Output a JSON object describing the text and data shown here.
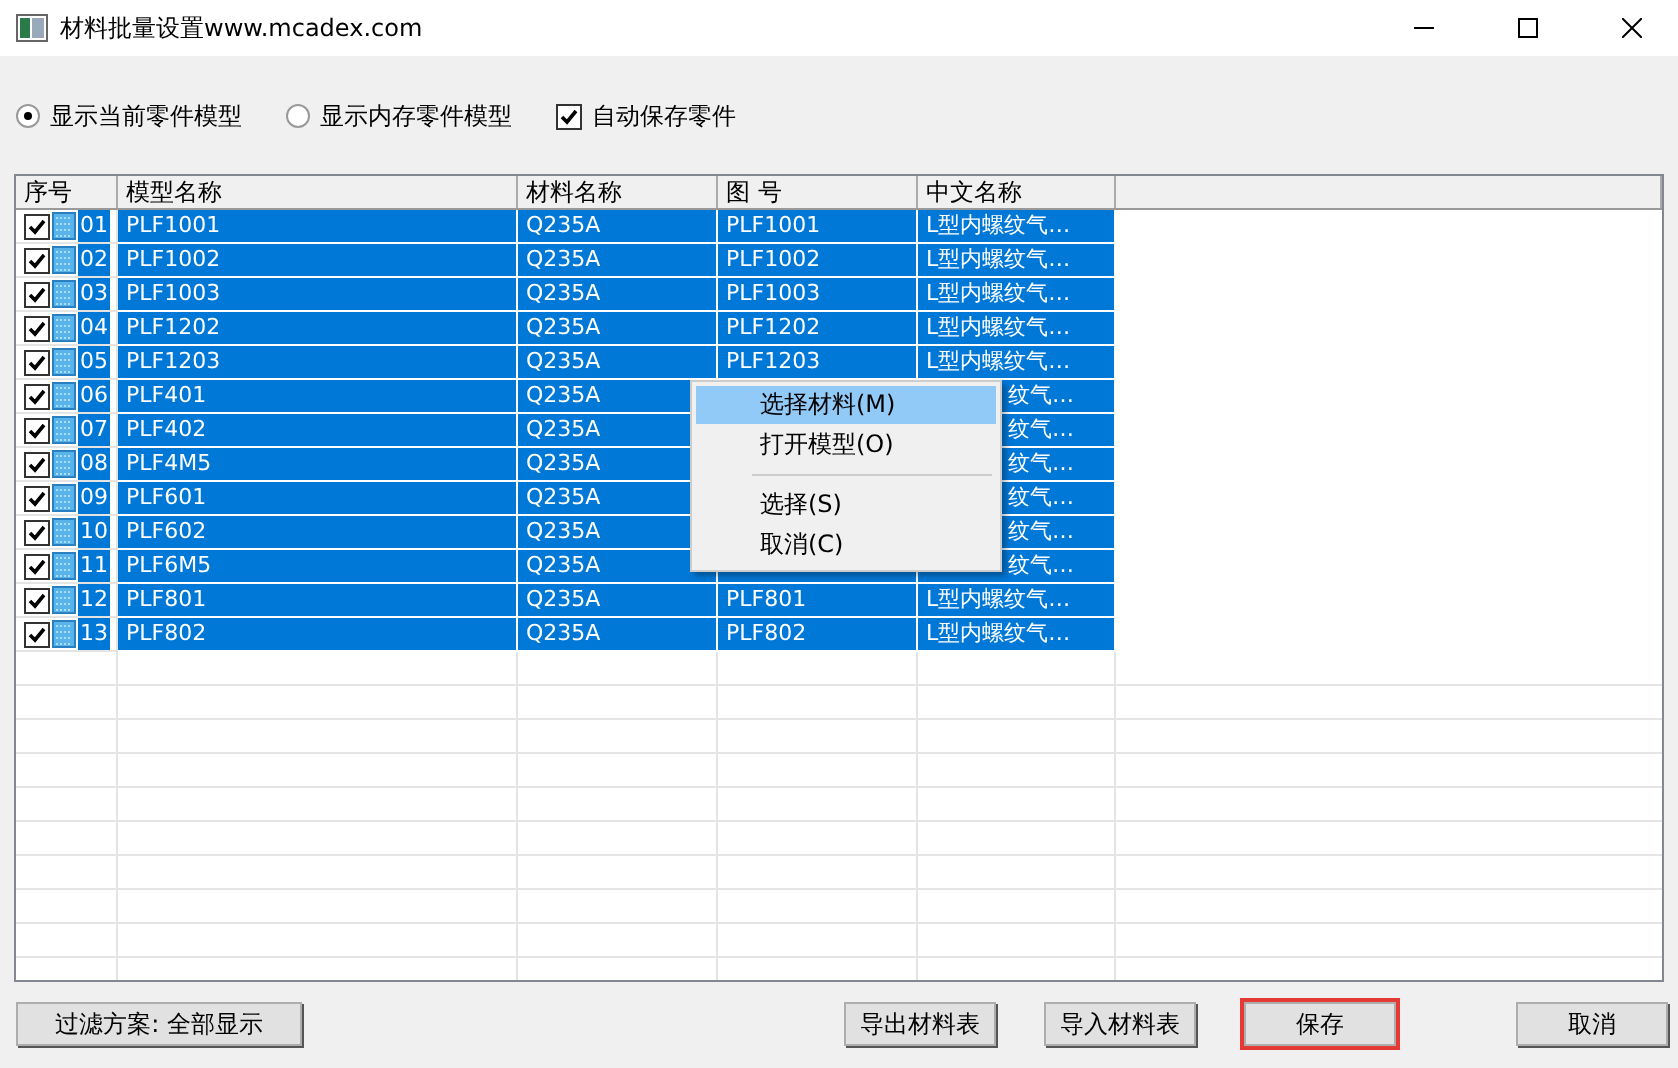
{
  "window": {
    "title": "材料批量设置www.mcadex.com"
  },
  "options": [
    {
      "kind": "radio",
      "label": "显示当前零件模型",
      "selected": true
    },
    {
      "kind": "radio",
      "label": "显示内存零件模型",
      "selected": false
    },
    {
      "kind": "checkbox",
      "label": "自动保存零件",
      "checked": true
    }
  ],
  "table": {
    "columns": [
      "序号",
      "模型名称",
      "材料名称",
      "图 号",
      "中文名称"
    ],
    "rows": [
      {
        "no": "01",
        "model": "PLF1001",
        "material": "Q235A",
        "drawing": "PLF1001",
        "name": "L型内螺纹气…",
        "checked": true,
        "selected": true
      },
      {
        "no": "02",
        "model": "PLF1002",
        "material": "Q235A",
        "drawing": "PLF1002",
        "name": "L型内螺纹气…",
        "checked": true,
        "selected": true
      },
      {
        "no": "03",
        "model": "PLF1003",
        "material": "Q235A",
        "drawing": "PLF1003",
        "name": "L型内螺纹气…",
        "checked": true,
        "selected": true
      },
      {
        "no": "04",
        "model": "PLF1202",
        "material": "Q235A",
        "drawing": "PLF1202",
        "name": "L型内螺纹气…",
        "checked": true,
        "selected": true
      },
      {
        "no": "05",
        "model": "PLF1203",
        "material": "Q235A",
        "drawing": "PLF1203",
        "name": "L型内螺纹气…",
        "checked": true,
        "selected": true
      },
      {
        "no": "06",
        "model": "PLF401",
        "material": "Q235A",
        "name": "纹气…",
        "covered": true,
        "checked": true,
        "selected": true
      },
      {
        "no": "07",
        "model": "PLF402",
        "material": "Q235A",
        "name": "纹气…",
        "covered": true,
        "checked": true,
        "selected": true
      },
      {
        "no": "08",
        "model": "PLF4M5",
        "material": "Q235A",
        "name": "纹气…",
        "covered": true,
        "checked": true,
        "selected": true
      },
      {
        "no": "09",
        "model": "PLF601",
        "material": "Q235A",
        "name": "纹气…",
        "covered": true,
        "checked": true,
        "selected": true
      },
      {
        "no": "10",
        "model": "PLF602",
        "material": "Q235A",
        "name": "纹气…",
        "covered": true,
        "checked": true,
        "selected": true
      },
      {
        "no": "11",
        "model": "PLF6M5",
        "material": "Q235A",
        "name": "纹气…",
        "covered": true,
        "checked": true,
        "selected": true
      },
      {
        "no": "12",
        "model": "PLF801",
        "material": "Q235A",
        "drawing": "PLF801",
        "name": "L型内螺纹气…",
        "checked": true,
        "selected": true
      },
      {
        "no": "13",
        "model": "PLF802",
        "material": "Q235A",
        "drawing": "PLF802",
        "name": "L型内螺纹气…",
        "checked": true,
        "selected": true
      }
    ]
  },
  "context_menu": [
    {
      "kind": "item",
      "label": "选择材料(M)",
      "selected": true
    },
    {
      "kind": "item",
      "label": "打开模型(O)",
      "selected": false
    },
    {
      "kind": "separator"
    },
    {
      "kind": "item",
      "label": "选择(S)",
      "selected": false
    },
    {
      "kind": "item",
      "label": "取消(C)",
      "selected": false
    }
  ],
  "buttons": [
    {
      "label": "过滤方案: 全部显示",
      "kind": "filter",
      "highlighted": false
    },
    {
      "label": "导出材料表",
      "kind": "action",
      "highlighted": false
    },
    {
      "label": "导入材料表",
      "kind": "action",
      "highlighted": false
    },
    {
      "label": "保存",
      "kind": "action",
      "highlighted": true
    },
    {
      "label": "取消",
      "kind": "action",
      "highlighted": false
    }
  ]
}
